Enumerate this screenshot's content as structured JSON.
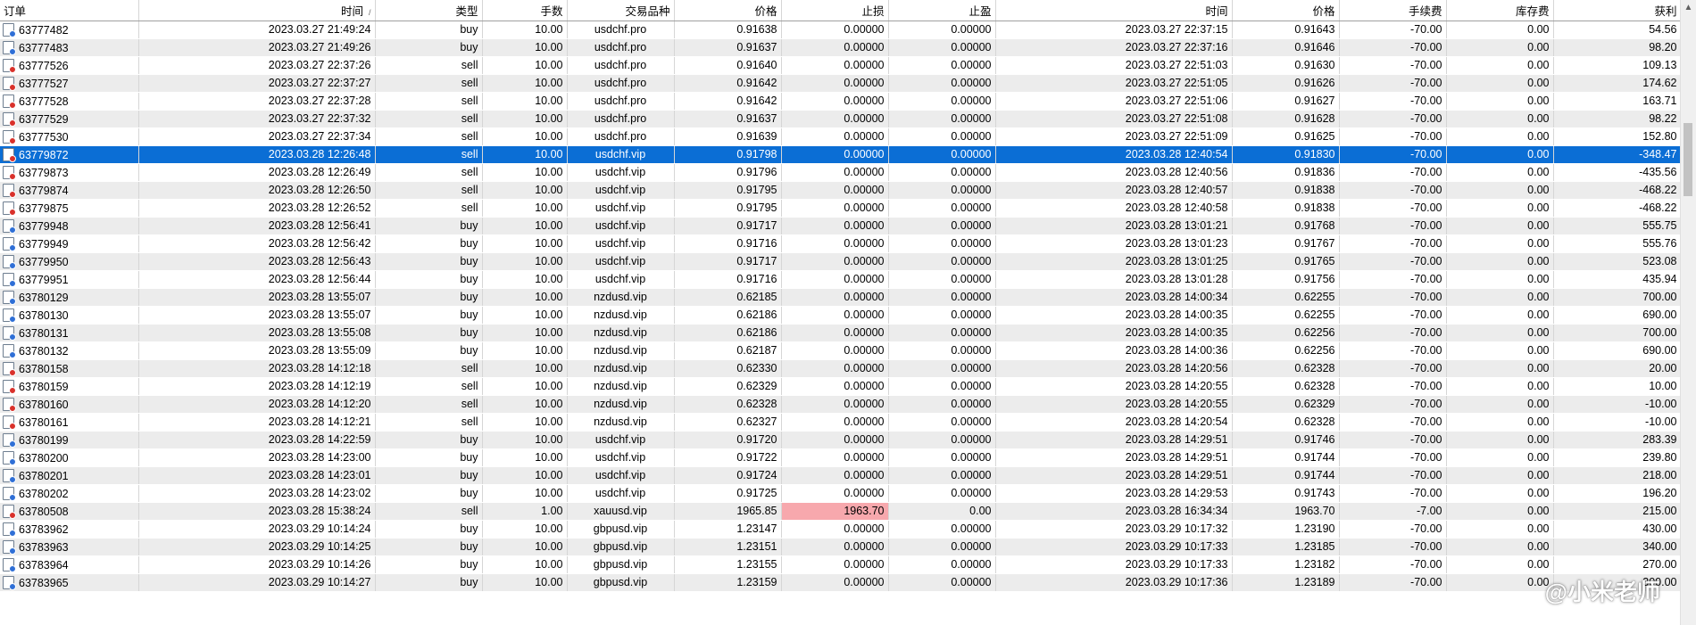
{
  "columns": [
    "订单",
    "时间",
    "类型",
    "手数",
    "交易品种",
    "价格",
    "止损",
    "止盈",
    "时间",
    "价格",
    "手续费",
    "库存费",
    "获利"
  ],
  "sort_indicator": "/",
  "selected_index": 7,
  "rows": [
    [
      "63777482",
      "2023.03.27 21:49:24",
      "buy",
      "10.00",
      "usdchf.pro",
      "0.91638",
      "0.00000",
      "0.00000",
      "2023.03.27 22:37:15",
      "0.91643",
      "-70.00",
      "0.00",
      "54.56"
    ],
    [
      "63777483",
      "2023.03.27 21:49:26",
      "buy",
      "10.00",
      "usdchf.pro",
      "0.91637",
      "0.00000",
      "0.00000",
      "2023.03.27 22:37:16",
      "0.91646",
      "-70.00",
      "0.00",
      "98.20"
    ],
    [
      "63777526",
      "2023.03.27 22:37:26",
      "sell",
      "10.00",
      "usdchf.pro",
      "0.91640",
      "0.00000",
      "0.00000",
      "2023.03.27 22:51:03",
      "0.91630",
      "-70.00",
      "0.00",
      "109.13"
    ],
    [
      "63777527",
      "2023.03.27 22:37:27",
      "sell",
      "10.00",
      "usdchf.pro",
      "0.91642",
      "0.00000",
      "0.00000",
      "2023.03.27 22:51:05",
      "0.91626",
      "-70.00",
      "0.00",
      "174.62"
    ],
    [
      "63777528",
      "2023.03.27 22:37:28",
      "sell",
      "10.00",
      "usdchf.pro",
      "0.91642",
      "0.00000",
      "0.00000",
      "2023.03.27 22:51:06",
      "0.91627",
      "-70.00",
      "0.00",
      "163.71"
    ],
    [
      "63777529",
      "2023.03.27 22:37:32",
      "sell",
      "10.00",
      "usdchf.pro",
      "0.91637",
      "0.00000",
      "0.00000",
      "2023.03.27 22:51:08",
      "0.91628",
      "-70.00",
      "0.00",
      "98.22"
    ],
    [
      "63777530",
      "2023.03.27 22:37:34",
      "sell",
      "10.00",
      "usdchf.pro",
      "0.91639",
      "0.00000",
      "0.00000",
      "2023.03.27 22:51:09",
      "0.91625",
      "-70.00",
      "0.00",
      "152.80"
    ],
    [
      "63779872",
      "2023.03.28 12:26:48",
      "sell",
      "10.00",
      "usdchf.vip",
      "0.91798",
      "0.00000",
      "0.00000",
      "2023.03.28 12:40:54",
      "0.91830",
      "-70.00",
      "0.00",
      "-348.47"
    ],
    [
      "63779873",
      "2023.03.28 12:26:49",
      "sell",
      "10.00",
      "usdchf.vip",
      "0.91796",
      "0.00000",
      "0.00000",
      "2023.03.28 12:40:56",
      "0.91836",
      "-70.00",
      "0.00",
      "-435.56"
    ],
    [
      "63779874",
      "2023.03.28 12:26:50",
      "sell",
      "10.00",
      "usdchf.vip",
      "0.91795",
      "0.00000",
      "0.00000",
      "2023.03.28 12:40:57",
      "0.91838",
      "-70.00",
      "0.00",
      "-468.22"
    ],
    [
      "63779875",
      "2023.03.28 12:26:52",
      "sell",
      "10.00",
      "usdchf.vip",
      "0.91795",
      "0.00000",
      "0.00000",
      "2023.03.28 12:40:58",
      "0.91838",
      "-70.00",
      "0.00",
      "-468.22"
    ],
    [
      "63779948",
      "2023.03.28 12:56:41",
      "buy",
      "10.00",
      "usdchf.vip",
      "0.91717",
      "0.00000",
      "0.00000",
      "2023.03.28 13:01:21",
      "0.91768",
      "-70.00",
      "0.00",
      "555.75"
    ],
    [
      "63779949",
      "2023.03.28 12:56:42",
      "buy",
      "10.00",
      "usdchf.vip",
      "0.91716",
      "0.00000",
      "0.00000",
      "2023.03.28 13:01:23",
      "0.91767",
      "-70.00",
      "0.00",
      "555.76"
    ],
    [
      "63779950",
      "2023.03.28 12:56:43",
      "buy",
      "10.00",
      "usdchf.vip",
      "0.91717",
      "0.00000",
      "0.00000",
      "2023.03.28 13:01:25",
      "0.91765",
      "-70.00",
      "0.00",
      "523.08"
    ],
    [
      "63779951",
      "2023.03.28 12:56:44",
      "buy",
      "10.00",
      "usdchf.vip",
      "0.91716",
      "0.00000",
      "0.00000",
      "2023.03.28 13:01:28",
      "0.91756",
      "-70.00",
      "0.00",
      "435.94"
    ],
    [
      "63780129",
      "2023.03.28 13:55:07",
      "buy",
      "10.00",
      "nzdusd.vip",
      "0.62185",
      "0.00000",
      "0.00000",
      "2023.03.28 14:00:34",
      "0.62255",
      "-70.00",
      "0.00",
      "700.00"
    ],
    [
      "63780130",
      "2023.03.28 13:55:07",
      "buy",
      "10.00",
      "nzdusd.vip",
      "0.62186",
      "0.00000",
      "0.00000",
      "2023.03.28 14:00:35",
      "0.62255",
      "-70.00",
      "0.00",
      "690.00"
    ],
    [
      "63780131",
      "2023.03.28 13:55:08",
      "buy",
      "10.00",
      "nzdusd.vip",
      "0.62186",
      "0.00000",
      "0.00000",
      "2023.03.28 14:00:35",
      "0.62256",
      "-70.00",
      "0.00",
      "700.00"
    ],
    [
      "63780132",
      "2023.03.28 13:55:09",
      "buy",
      "10.00",
      "nzdusd.vip",
      "0.62187",
      "0.00000",
      "0.00000",
      "2023.03.28 14:00:36",
      "0.62256",
      "-70.00",
      "0.00",
      "690.00"
    ],
    [
      "63780158",
      "2023.03.28 14:12:18",
      "sell",
      "10.00",
      "nzdusd.vip",
      "0.62330",
      "0.00000",
      "0.00000",
      "2023.03.28 14:20:56",
      "0.62328",
      "-70.00",
      "0.00",
      "20.00"
    ],
    [
      "63780159",
      "2023.03.28 14:12:19",
      "sell",
      "10.00",
      "nzdusd.vip",
      "0.62329",
      "0.00000",
      "0.00000",
      "2023.03.28 14:20:55",
      "0.62328",
      "-70.00",
      "0.00",
      "10.00"
    ],
    [
      "63780160",
      "2023.03.28 14:12:20",
      "sell",
      "10.00",
      "nzdusd.vip",
      "0.62328",
      "0.00000",
      "0.00000",
      "2023.03.28 14:20:55",
      "0.62329",
      "-70.00",
      "0.00",
      "-10.00"
    ],
    [
      "63780161",
      "2023.03.28 14:12:21",
      "sell",
      "10.00",
      "nzdusd.vip",
      "0.62327",
      "0.00000",
      "0.00000",
      "2023.03.28 14:20:54",
      "0.62328",
      "-70.00",
      "0.00",
      "-10.00"
    ],
    [
      "63780199",
      "2023.03.28 14:22:59",
      "buy",
      "10.00",
      "usdchf.vip",
      "0.91720",
      "0.00000",
      "0.00000",
      "2023.03.28 14:29:51",
      "0.91746",
      "-70.00",
      "0.00",
      "283.39"
    ],
    [
      "63780200",
      "2023.03.28 14:23:00",
      "buy",
      "10.00",
      "usdchf.vip",
      "0.91722",
      "0.00000",
      "0.00000",
      "2023.03.28 14:29:51",
      "0.91744",
      "-70.00",
      "0.00",
      "239.80"
    ],
    [
      "63780201",
      "2023.03.28 14:23:01",
      "buy",
      "10.00",
      "usdchf.vip",
      "0.91724",
      "0.00000",
      "0.00000",
      "2023.03.28 14:29:51",
      "0.91744",
      "-70.00",
      "0.00",
      "218.00"
    ],
    [
      "63780202",
      "2023.03.28 14:23:02",
      "buy",
      "10.00",
      "usdchf.vip",
      "0.91725",
      "0.00000",
      "0.00000",
      "2023.03.28 14:29:53",
      "0.91743",
      "-70.00",
      "0.00",
      "196.20"
    ],
    [
      "63780508",
      "2023.03.28 15:38:24",
      "sell",
      "1.00",
      "xauusd.vip",
      "1965.85",
      "1963.70",
      "0.00",
      "2023.03.28 16:34:34",
      "1963.70",
      "-7.00",
      "0.00",
      "215.00"
    ],
    [
      "63783962",
      "2023.03.29 10:14:24",
      "buy",
      "10.00",
      "gbpusd.vip",
      "1.23147",
      "0.00000",
      "0.00000",
      "2023.03.29 10:17:32",
      "1.23190",
      "-70.00",
      "0.00",
      "430.00"
    ],
    [
      "63783963",
      "2023.03.29 10:14:25",
      "buy",
      "10.00",
      "gbpusd.vip",
      "1.23151",
      "0.00000",
      "0.00000",
      "2023.03.29 10:17:33",
      "1.23185",
      "-70.00",
      "0.00",
      "340.00"
    ],
    [
      "63783964",
      "2023.03.29 10:14:26",
      "buy",
      "10.00",
      "gbpusd.vip",
      "1.23155",
      "0.00000",
      "0.00000",
      "2023.03.29 10:17:33",
      "1.23182",
      "-70.00",
      "0.00",
      "270.00"
    ],
    [
      "63783965",
      "2023.03.29 10:14:27",
      "buy",
      "10.00",
      "gbpusd.vip",
      "1.23159",
      "0.00000",
      "0.00000",
      "2023.03.29 10:17:36",
      "1.23189",
      "-70.00",
      "0.00",
      "300.00"
    ]
  ],
  "highlight_cell": {
    "row": 27,
    "col": 6,
    "color": "#f7a8ad"
  },
  "colors": {
    "selected": "#0b6ed5",
    "stripe": "#ececec",
    "buy_icon": "#2f6fd6",
    "sell_icon": "#d9312b"
  },
  "watermark": "@小米老师"
}
